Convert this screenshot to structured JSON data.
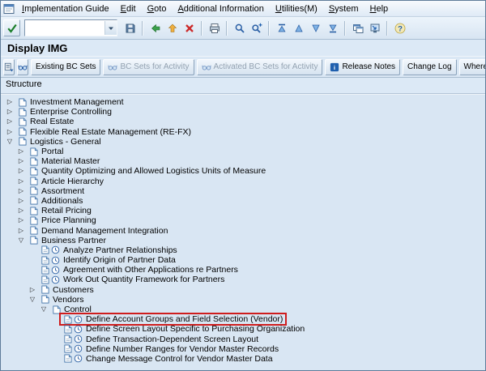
{
  "window": {
    "title": "Display IMG"
  },
  "menu_bar": {
    "system_icon": "system-menu-icon",
    "items": [
      "Implementation Guide",
      "Edit",
      "Goto",
      "Additional Information",
      "Utilities(M)",
      "System",
      "Help"
    ]
  },
  "toolbar": {
    "enter_button": {
      "name": "enter-button",
      "icon": "check-icon"
    },
    "command_field": {
      "value": "",
      "placeholder": "",
      "dropdown_icon": "dropdown-icon"
    },
    "buttons": [
      {
        "name": "save-button",
        "icon": "save-icon"
      },
      {
        "type": "separator"
      },
      {
        "name": "back-button",
        "icon": "back-icon"
      },
      {
        "name": "exit-button",
        "icon": "exit-icon"
      },
      {
        "name": "cancel-button",
        "icon": "cancel-icon"
      },
      {
        "type": "separator"
      },
      {
        "name": "print-button",
        "icon": "print-icon"
      },
      {
        "type": "separator"
      },
      {
        "name": "find-button",
        "icon": "find-icon"
      },
      {
        "name": "find-next-button",
        "icon": "find-next-icon"
      },
      {
        "type": "separator"
      },
      {
        "name": "first-page-button",
        "icon": "first-page-icon"
      },
      {
        "name": "page-up-button",
        "icon": "page-up-icon"
      },
      {
        "name": "page-down-button",
        "icon": "page-down-icon"
      },
      {
        "name": "last-page-button",
        "icon": "last-page-icon"
      },
      {
        "type": "separator"
      },
      {
        "name": "new-session-button",
        "icon": "new-session-icon"
      },
      {
        "name": "shortcut-button",
        "icon": "shortcut-icon"
      },
      {
        "type": "separator"
      },
      {
        "name": "help-button",
        "icon": "help-icon"
      }
    ]
  },
  "app_toolbar": {
    "buttons": [
      {
        "name": "structure-display-button",
        "icon": "layout-icon",
        "label": null,
        "enabled": true
      },
      {
        "name": "display-glasses-button",
        "icon": "glasses-icon",
        "label": null,
        "enabled": true
      },
      {
        "name": "existing-bc-sets-button",
        "icon": null,
        "label": "Existing BC Sets",
        "enabled": true
      },
      {
        "name": "bc-sets-for-activity-button",
        "icon": "glasses-icon",
        "label": "BC Sets for Activity",
        "enabled": false
      },
      {
        "name": "activated-bc-sets-for-activity-button",
        "icon": "glasses-icon",
        "label": "Activated BC Sets for Activity",
        "enabled": false
      },
      {
        "name": "release-notes-button",
        "icon": "info-icon",
        "label": "Release Notes",
        "enabled": true
      },
      {
        "name": "change-log-button",
        "icon": null,
        "label": "Change Log",
        "enabled": true
      },
      {
        "name": "where-else-used-button",
        "icon": null,
        "label": "Where Else Used",
        "enabled": true
      }
    ]
  },
  "structure": {
    "header": "Structure"
  },
  "colors": {
    "selection_box": "#cf1d1d",
    "background": "#dce9f6",
    "tree_background": "#d9e6f3"
  },
  "tree": {
    "rows": [
      {
        "level": 0,
        "type": "node",
        "state": "collapsed",
        "label": "Investment Management",
        "selected": false
      },
      {
        "level": 0,
        "type": "node",
        "state": "collapsed",
        "label": "Enterprise Controlling",
        "selected": false
      },
      {
        "level": 0,
        "type": "node",
        "state": "collapsed",
        "label": "Real Estate",
        "selected": false
      },
      {
        "level": 0,
        "type": "node",
        "state": "collapsed",
        "label": "Flexible Real Estate Management (RE-FX)",
        "selected": false
      },
      {
        "level": 0,
        "type": "node",
        "state": "expanded",
        "label": "Logistics - General",
        "selected": false
      },
      {
        "level": 1,
        "type": "node",
        "state": "collapsed",
        "label": "Portal",
        "selected": false
      },
      {
        "level": 1,
        "type": "node",
        "state": "collapsed",
        "label": "Material Master",
        "selected": false
      },
      {
        "level": 1,
        "type": "node",
        "state": "collapsed",
        "label": "Quantity Optimizing and Allowed Logistics Units of Measure",
        "selected": false
      },
      {
        "level": 1,
        "type": "node",
        "state": "collapsed",
        "label": "Article Hierarchy",
        "selected": false
      },
      {
        "level": 1,
        "type": "node",
        "state": "collapsed",
        "label": "Assortment",
        "selected": false
      },
      {
        "level": 1,
        "type": "node",
        "state": "collapsed",
        "label": "Additionals",
        "selected": false
      },
      {
        "level": 1,
        "type": "node",
        "state": "collapsed",
        "label": "Retail Pricing",
        "selected": false
      },
      {
        "level": 1,
        "type": "node",
        "state": "collapsed",
        "label": "Price Planning",
        "selected": false
      },
      {
        "level": 1,
        "type": "node",
        "state": "collapsed",
        "label": "Demand Management Integration",
        "selected": false
      },
      {
        "level": 1,
        "type": "node",
        "state": "expanded",
        "label": "Business Partner",
        "selected": false
      },
      {
        "level": 2,
        "type": "activity",
        "state": null,
        "label": "Analyze Partner Relationships",
        "selected": false
      },
      {
        "level": 2,
        "type": "activity",
        "state": null,
        "label": "Identify Origin of Partner Data",
        "selected": false
      },
      {
        "level": 2,
        "type": "activity",
        "state": null,
        "label": "Agreement with Other Applications re Partners",
        "selected": false
      },
      {
        "level": 2,
        "type": "activity",
        "state": null,
        "label": "Work Out Quantity Framework for Partners",
        "selected": false
      },
      {
        "level": 2,
        "type": "node",
        "state": "collapsed",
        "label": "Customers",
        "selected": false
      },
      {
        "level": 2,
        "type": "node",
        "state": "expanded",
        "label": "Vendors",
        "selected": false
      },
      {
        "level": 3,
        "type": "node",
        "state": "expanded",
        "label": "Control",
        "selected": false
      },
      {
        "level": 4,
        "type": "activity",
        "state": null,
        "label": "Define Account Groups and Field Selection (Vendor)",
        "selected": true
      },
      {
        "level": 4,
        "type": "activity",
        "state": null,
        "label": "Define Screen Layout Specific to Purchasing Organization",
        "selected": false
      },
      {
        "level": 4,
        "type": "activity",
        "state": null,
        "label": "Define Transaction-Dependent Screen Layout",
        "selected": false
      },
      {
        "level": 4,
        "type": "activity",
        "state": null,
        "label": "Define Number Ranges for Vendor Master Records",
        "selected": false
      },
      {
        "level": 4,
        "type": "activity",
        "state": null,
        "label": "Change Message Control for Vendor Master Data",
        "selected": false
      }
    ]
  }
}
